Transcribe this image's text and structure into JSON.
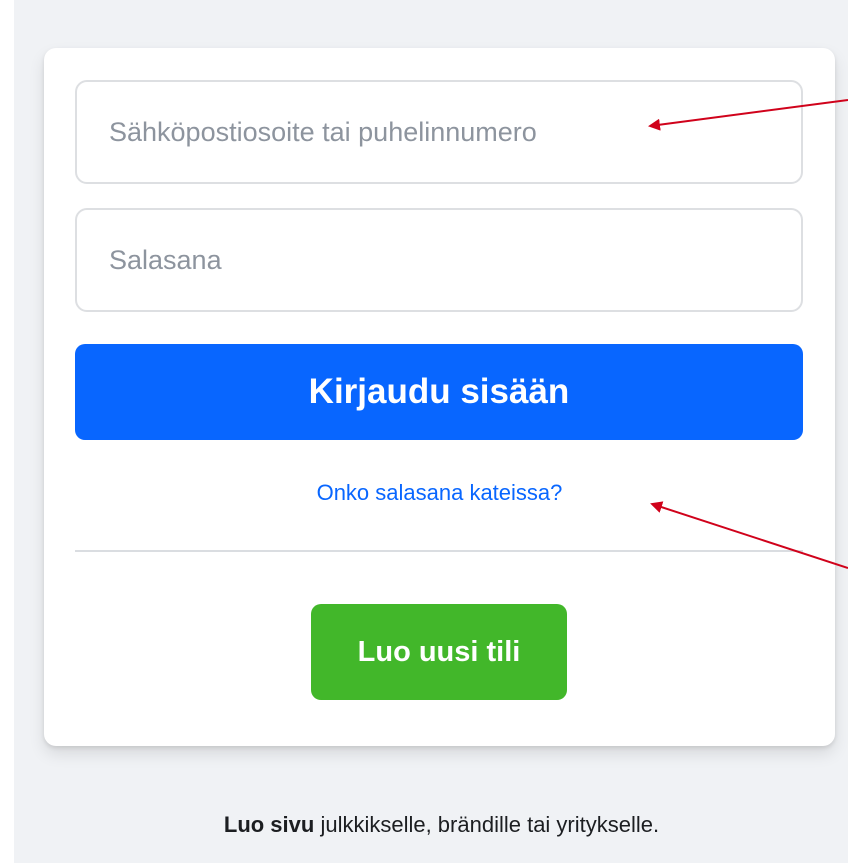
{
  "login_form": {
    "email_placeholder": "Sähköpostiosoite tai puhelinnumero",
    "email_value": "",
    "password_placeholder": "Salasana",
    "password_value": "",
    "login_label": "Kirjaudu sisään",
    "forgot_password_label": "Onko salasana kateissa?",
    "create_account_label": "Luo uusi tili"
  },
  "footer": {
    "create_page_link": "Luo sivu",
    "create_page_text": " julkkikselle, brändille tai yritykselle."
  },
  "colors": {
    "background": "#f0f2f5",
    "primary_blue": "#0866ff",
    "create_green": "#42b72a",
    "annotation_red": "#d0021b"
  }
}
